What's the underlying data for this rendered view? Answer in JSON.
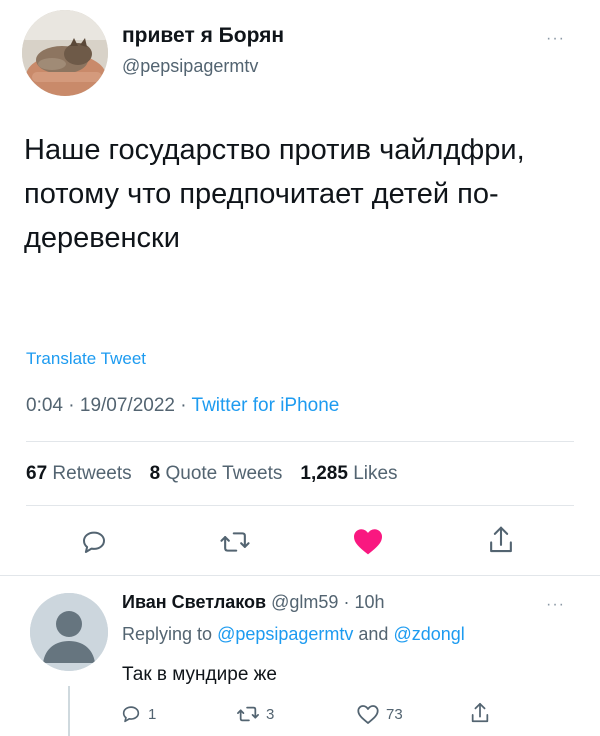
{
  "author": {
    "display_name": "привет я Борян",
    "handle": "@pepsipagermtv",
    "avatar": "photo of a cat held in arms"
  },
  "tweet": {
    "text": "Наше государство против чайлдфри, потому что предпочитает детей по-деревенски",
    "translate_label": "Translate Tweet",
    "time": "0:04",
    "date": "19/07/2022",
    "via": "Twitter for iPhone",
    "separator": " · "
  },
  "stats": {
    "retweets_count": "67",
    "retweets_label": "Retweets",
    "quotes_count": "8",
    "quotes_label": "Quote Tweets",
    "likes_count": "1,285",
    "likes_label": "Likes"
  },
  "actions": {
    "icons": [
      "reply-icon",
      "retweet-icon",
      "like-icon-filled",
      "share-icon"
    ],
    "like_color": "#f91880",
    "icon_color": "#536471"
  },
  "more_label": "···",
  "reply": {
    "display_name": "Иван Светлаков",
    "handle": "@glm59",
    "time": "10h",
    "separator": " · ",
    "replying_prefix": "Replying to ",
    "replying_user1": "@pepsipagermtv",
    "replying_and": " and ",
    "replying_user2": "@zdongl",
    "text": "Так в мундире же",
    "reply_count": "1",
    "retweet_count": "3",
    "like_count": "73"
  },
  "colors": {
    "accent": "#1d9bf0",
    "muted": "#536471",
    "text": "#0f1419"
  }
}
